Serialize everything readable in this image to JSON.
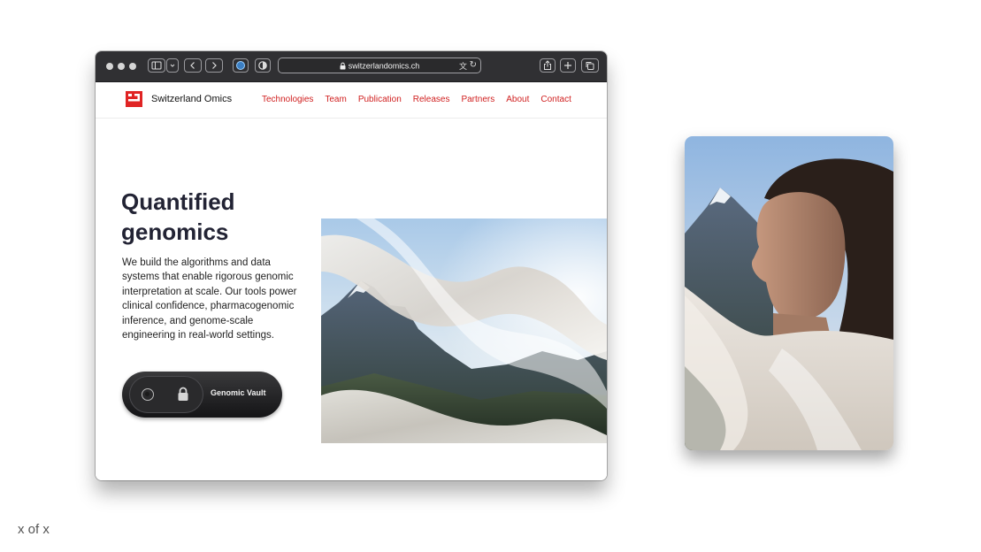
{
  "browser": {
    "url": "switzerlandomics.ch",
    "icons": [
      "sidebar-icon",
      "back-icon",
      "forward-icon",
      "extension-icon",
      "shield-icon",
      "lock-icon",
      "translate-icon",
      "reload-icon",
      "share-icon",
      "new-tab-icon",
      "tabs-icon"
    ]
  },
  "site": {
    "brand": "Switzerland Omics",
    "nav": [
      "Technologies",
      "Team",
      "Publication",
      "Releases",
      "Partners",
      "About",
      "Contact"
    ],
    "hero": {
      "title_line1": "Quantified",
      "title_line2": "genomics",
      "body": "We build the algorithms and data systems that enable rigorous genomic interpretation at scale. Our tools power clinical confidence, pharmacogenomic inference, and genome-scale engineering in real-world settings.",
      "vault_label": "Genomic Vault"
    }
  },
  "footer": {
    "pager": "x of x"
  },
  "colors": {
    "accent": "#d01f1f",
    "title": "#222334",
    "toolbar": "#303033"
  }
}
